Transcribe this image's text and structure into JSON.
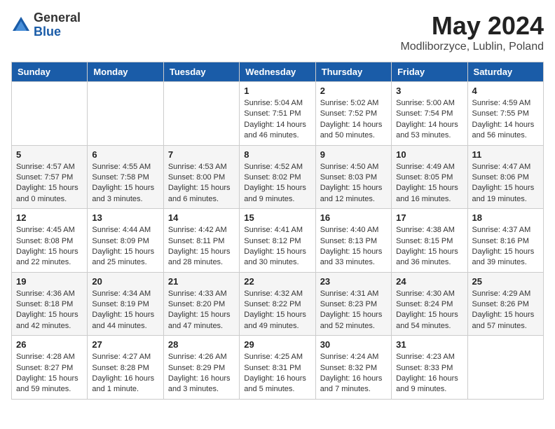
{
  "header": {
    "logo_general": "General",
    "logo_blue": "Blue",
    "month": "May 2024",
    "location": "Modliborzyce, Lublin, Poland"
  },
  "weekdays": [
    "Sunday",
    "Monday",
    "Tuesday",
    "Wednesday",
    "Thursday",
    "Friday",
    "Saturday"
  ],
  "weeks": [
    [
      {
        "day": "",
        "sunrise": "",
        "sunset": "",
        "daylight": ""
      },
      {
        "day": "",
        "sunrise": "",
        "sunset": "",
        "daylight": ""
      },
      {
        "day": "",
        "sunrise": "",
        "sunset": "",
        "daylight": ""
      },
      {
        "day": "1",
        "sunrise": "Sunrise: 5:04 AM",
        "sunset": "Sunset: 7:51 PM",
        "daylight": "Daylight: 14 hours and 46 minutes."
      },
      {
        "day": "2",
        "sunrise": "Sunrise: 5:02 AM",
        "sunset": "Sunset: 7:52 PM",
        "daylight": "Daylight: 14 hours and 50 minutes."
      },
      {
        "day": "3",
        "sunrise": "Sunrise: 5:00 AM",
        "sunset": "Sunset: 7:54 PM",
        "daylight": "Daylight: 14 hours and 53 minutes."
      },
      {
        "day": "4",
        "sunrise": "Sunrise: 4:59 AM",
        "sunset": "Sunset: 7:55 PM",
        "daylight": "Daylight: 14 hours and 56 minutes."
      }
    ],
    [
      {
        "day": "5",
        "sunrise": "Sunrise: 4:57 AM",
        "sunset": "Sunset: 7:57 PM",
        "daylight": "Daylight: 15 hours and 0 minutes."
      },
      {
        "day": "6",
        "sunrise": "Sunrise: 4:55 AM",
        "sunset": "Sunset: 7:58 PM",
        "daylight": "Daylight: 15 hours and 3 minutes."
      },
      {
        "day": "7",
        "sunrise": "Sunrise: 4:53 AM",
        "sunset": "Sunset: 8:00 PM",
        "daylight": "Daylight: 15 hours and 6 minutes."
      },
      {
        "day": "8",
        "sunrise": "Sunrise: 4:52 AM",
        "sunset": "Sunset: 8:02 PM",
        "daylight": "Daylight: 15 hours and 9 minutes."
      },
      {
        "day": "9",
        "sunrise": "Sunrise: 4:50 AM",
        "sunset": "Sunset: 8:03 PM",
        "daylight": "Daylight: 15 hours and 12 minutes."
      },
      {
        "day": "10",
        "sunrise": "Sunrise: 4:49 AM",
        "sunset": "Sunset: 8:05 PM",
        "daylight": "Daylight: 15 hours and 16 minutes."
      },
      {
        "day": "11",
        "sunrise": "Sunrise: 4:47 AM",
        "sunset": "Sunset: 8:06 PM",
        "daylight": "Daylight: 15 hours and 19 minutes."
      }
    ],
    [
      {
        "day": "12",
        "sunrise": "Sunrise: 4:45 AM",
        "sunset": "Sunset: 8:08 PM",
        "daylight": "Daylight: 15 hours and 22 minutes."
      },
      {
        "day": "13",
        "sunrise": "Sunrise: 4:44 AM",
        "sunset": "Sunset: 8:09 PM",
        "daylight": "Daylight: 15 hours and 25 minutes."
      },
      {
        "day": "14",
        "sunrise": "Sunrise: 4:42 AM",
        "sunset": "Sunset: 8:11 PM",
        "daylight": "Daylight: 15 hours and 28 minutes."
      },
      {
        "day": "15",
        "sunrise": "Sunrise: 4:41 AM",
        "sunset": "Sunset: 8:12 PM",
        "daylight": "Daylight: 15 hours and 30 minutes."
      },
      {
        "day": "16",
        "sunrise": "Sunrise: 4:40 AM",
        "sunset": "Sunset: 8:13 PM",
        "daylight": "Daylight: 15 hours and 33 minutes."
      },
      {
        "day": "17",
        "sunrise": "Sunrise: 4:38 AM",
        "sunset": "Sunset: 8:15 PM",
        "daylight": "Daylight: 15 hours and 36 minutes."
      },
      {
        "day": "18",
        "sunrise": "Sunrise: 4:37 AM",
        "sunset": "Sunset: 8:16 PM",
        "daylight": "Daylight: 15 hours and 39 minutes."
      }
    ],
    [
      {
        "day": "19",
        "sunrise": "Sunrise: 4:36 AM",
        "sunset": "Sunset: 8:18 PM",
        "daylight": "Daylight: 15 hours and 42 minutes."
      },
      {
        "day": "20",
        "sunrise": "Sunrise: 4:34 AM",
        "sunset": "Sunset: 8:19 PM",
        "daylight": "Daylight: 15 hours and 44 minutes."
      },
      {
        "day": "21",
        "sunrise": "Sunrise: 4:33 AM",
        "sunset": "Sunset: 8:20 PM",
        "daylight": "Daylight: 15 hours and 47 minutes."
      },
      {
        "day": "22",
        "sunrise": "Sunrise: 4:32 AM",
        "sunset": "Sunset: 8:22 PM",
        "daylight": "Daylight: 15 hours and 49 minutes."
      },
      {
        "day": "23",
        "sunrise": "Sunrise: 4:31 AM",
        "sunset": "Sunset: 8:23 PM",
        "daylight": "Daylight: 15 hours and 52 minutes."
      },
      {
        "day": "24",
        "sunrise": "Sunrise: 4:30 AM",
        "sunset": "Sunset: 8:24 PM",
        "daylight": "Daylight: 15 hours and 54 minutes."
      },
      {
        "day": "25",
        "sunrise": "Sunrise: 4:29 AM",
        "sunset": "Sunset: 8:26 PM",
        "daylight": "Daylight: 15 hours and 57 minutes."
      }
    ],
    [
      {
        "day": "26",
        "sunrise": "Sunrise: 4:28 AM",
        "sunset": "Sunset: 8:27 PM",
        "daylight": "Daylight: 15 hours and 59 minutes."
      },
      {
        "day": "27",
        "sunrise": "Sunrise: 4:27 AM",
        "sunset": "Sunset: 8:28 PM",
        "daylight": "Daylight: 16 hours and 1 minute."
      },
      {
        "day": "28",
        "sunrise": "Sunrise: 4:26 AM",
        "sunset": "Sunset: 8:29 PM",
        "daylight": "Daylight: 16 hours and 3 minutes."
      },
      {
        "day": "29",
        "sunrise": "Sunrise: 4:25 AM",
        "sunset": "Sunset: 8:31 PM",
        "daylight": "Daylight: 16 hours and 5 minutes."
      },
      {
        "day": "30",
        "sunrise": "Sunrise: 4:24 AM",
        "sunset": "Sunset: 8:32 PM",
        "daylight": "Daylight: 16 hours and 7 minutes."
      },
      {
        "day": "31",
        "sunrise": "Sunrise: 4:23 AM",
        "sunset": "Sunset: 8:33 PM",
        "daylight": "Daylight: 16 hours and 9 minutes."
      },
      {
        "day": "",
        "sunrise": "",
        "sunset": "",
        "daylight": ""
      }
    ]
  ]
}
